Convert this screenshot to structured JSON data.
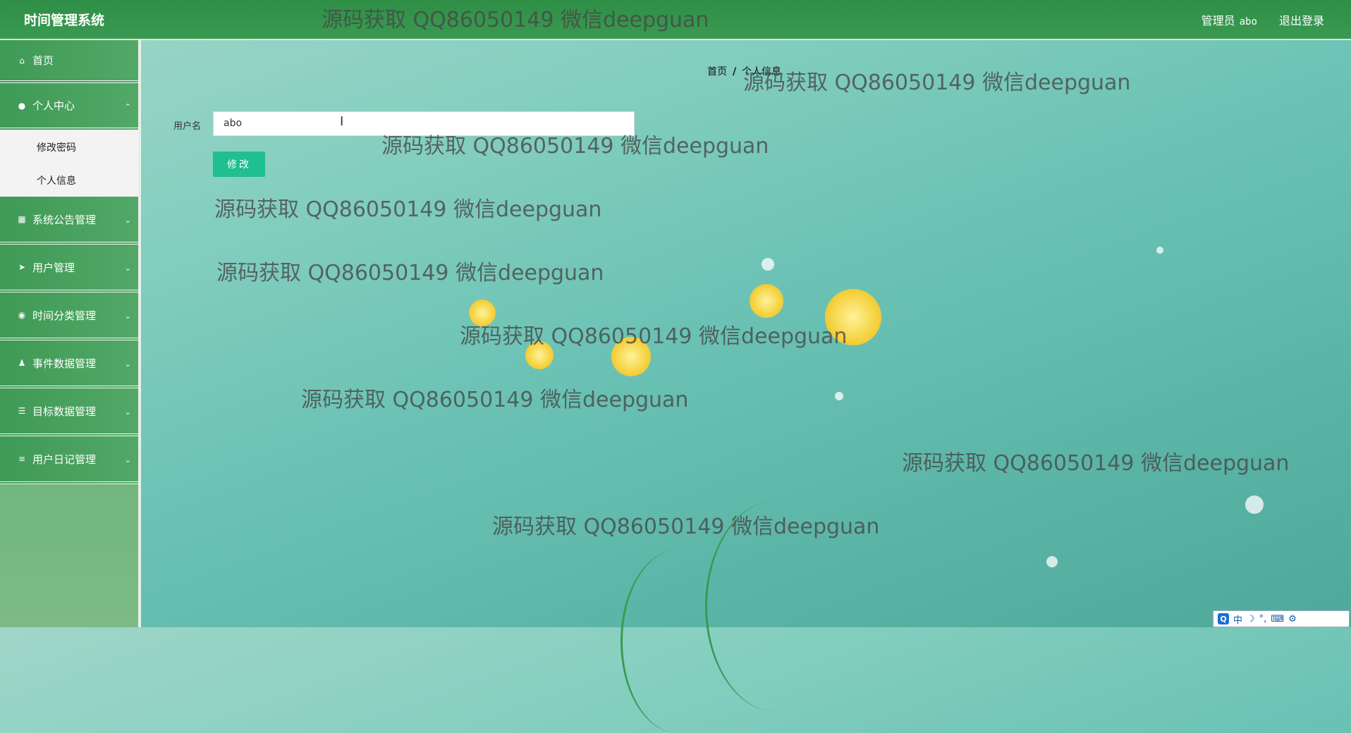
{
  "header": {
    "app_title": "时间管理系统",
    "role_label": "管理员",
    "username": "abo",
    "logout_label": "退出登录"
  },
  "sidebar": {
    "items": [
      {
        "label": "首页",
        "icon": "home-icon"
      },
      {
        "label": "个人中心",
        "icon": "user-icon",
        "expanded": true,
        "children": [
          {
            "label": "修改密码"
          },
          {
            "label": "个人信息"
          }
        ]
      },
      {
        "label": "系统公告管理",
        "icon": "grid-icon"
      },
      {
        "label": "用户管理",
        "icon": "send-icon"
      },
      {
        "label": "时间分类管理",
        "icon": "bulb-icon"
      },
      {
        "label": "事件数据管理",
        "icon": "person-icon"
      },
      {
        "label": "目标数据管理",
        "icon": "list-icon"
      },
      {
        "label": "用户日记管理",
        "icon": "sliders-icon"
      }
    ]
  },
  "breadcrumb": {
    "home": "首页",
    "separator": "/",
    "current": "个人信息"
  },
  "form": {
    "username_label": "用户名",
    "username_value": "abo",
    "submit_label": "修改"
  },
  "watermark": "源码获取 QQ86050149 微信deepguan",
  "ime": {
    "icon": "Q",
    "mode": "中",
    "items": [
      "☽",
      "°,",
      "⌨",
      "⚙"
    ]
  },
  "colors": {
    "header_green": "#2f8e46",
    "button_teal": "#1fbf8f",
    "sidebar_green": "#3e9a55"
  }
}
